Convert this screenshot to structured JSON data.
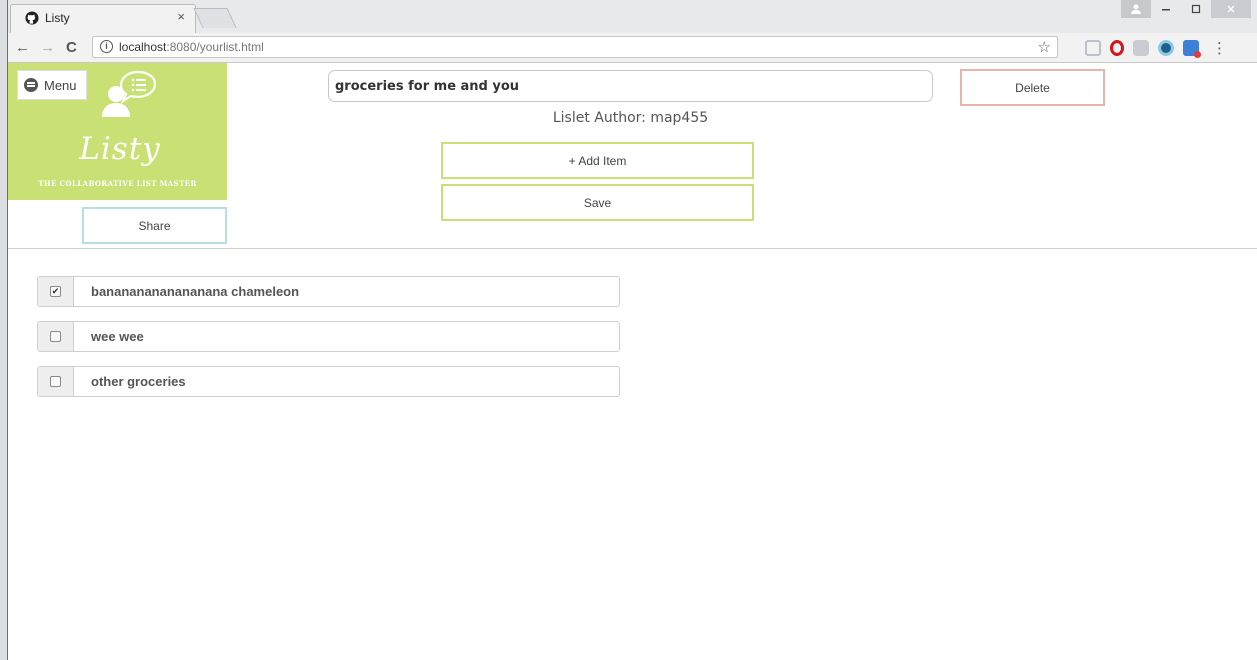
{
  "browser": {
    "tab_title": "Listy",
    "tab_close": "×",
    "url_host": "localhost",
    "url_rest": ":8080/yourlist.html"
  },
  "app": {
    "menu_label": "Menu",
    "logo_text": "Listy",
    "tagline": "THE COLLABORATIVE LIST MASTER",
    "share_label": "Share",
    "list_title": "groceries for me and you",
    "delete_label": "Delete",
    "author_line": "Lislet Author: map455",
    "add_item_label": "+ Add Item",
    "save_label": "Save"
  },
  "items": [
    {
      "text": "banananananananana chameleon",
      "checked": true
    },
    {
      "text": "wee wee",
      "checked": false
    },
    {
      "text": "other groceries",
      "checked": false
    }
  ],
  "colors": {
    "brand_green": "#c8e074",
    "share_border": "#b7dde6",
    "delete_border": "#e8b3ab"
  }
}
